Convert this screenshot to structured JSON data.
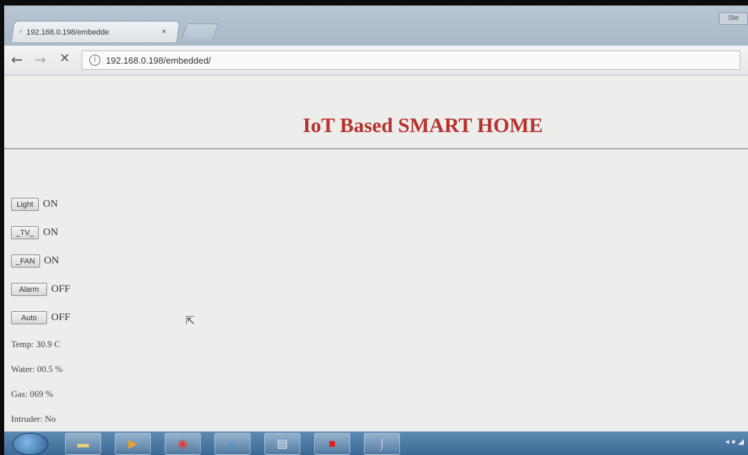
{
  "browser": {
    "tab_title": "192.168.0.198/embedde",
    "tab_close": "×",
    "url": "192.168.0.198/embedded/",
    "window_button": "Ste"
  },
  "page": {
    "title": "IoT Based SMART HOME",
    "controls": [
      {
        "button": "Light",
        "state": "ON"
      },
      {
        "button": "_TV_",
        "state": "ON"
      },
      {
        "button": "_FAN",
        "state": "ON"
      },
      {
        "button": "Alarm",
        "state": "OFF"
      },
      {
        "button": "Auto",
        "state": "OFF"
      }
    ],
    "readings": {
      "temp": "Temp: 30.9 C",
      "water": "Water: 00.5 %",
      "gas": "Gas: 069 %",
      "intruder": "Intruder: No"
    }
  },
  "taskbar": {
    "icons": [
      "windows-start-icon",
      "explorer-icon",
      "media-player-icon",
      "chrome-icon",
      "internet-explorer-icon",
      "document-icon",
      "acrobat-icon",
      "signature-app-icon"
    ]
  },
  "colors": {
    "title": "#b8322e",
    "taskbar": "#3c6a96"
  }
}
